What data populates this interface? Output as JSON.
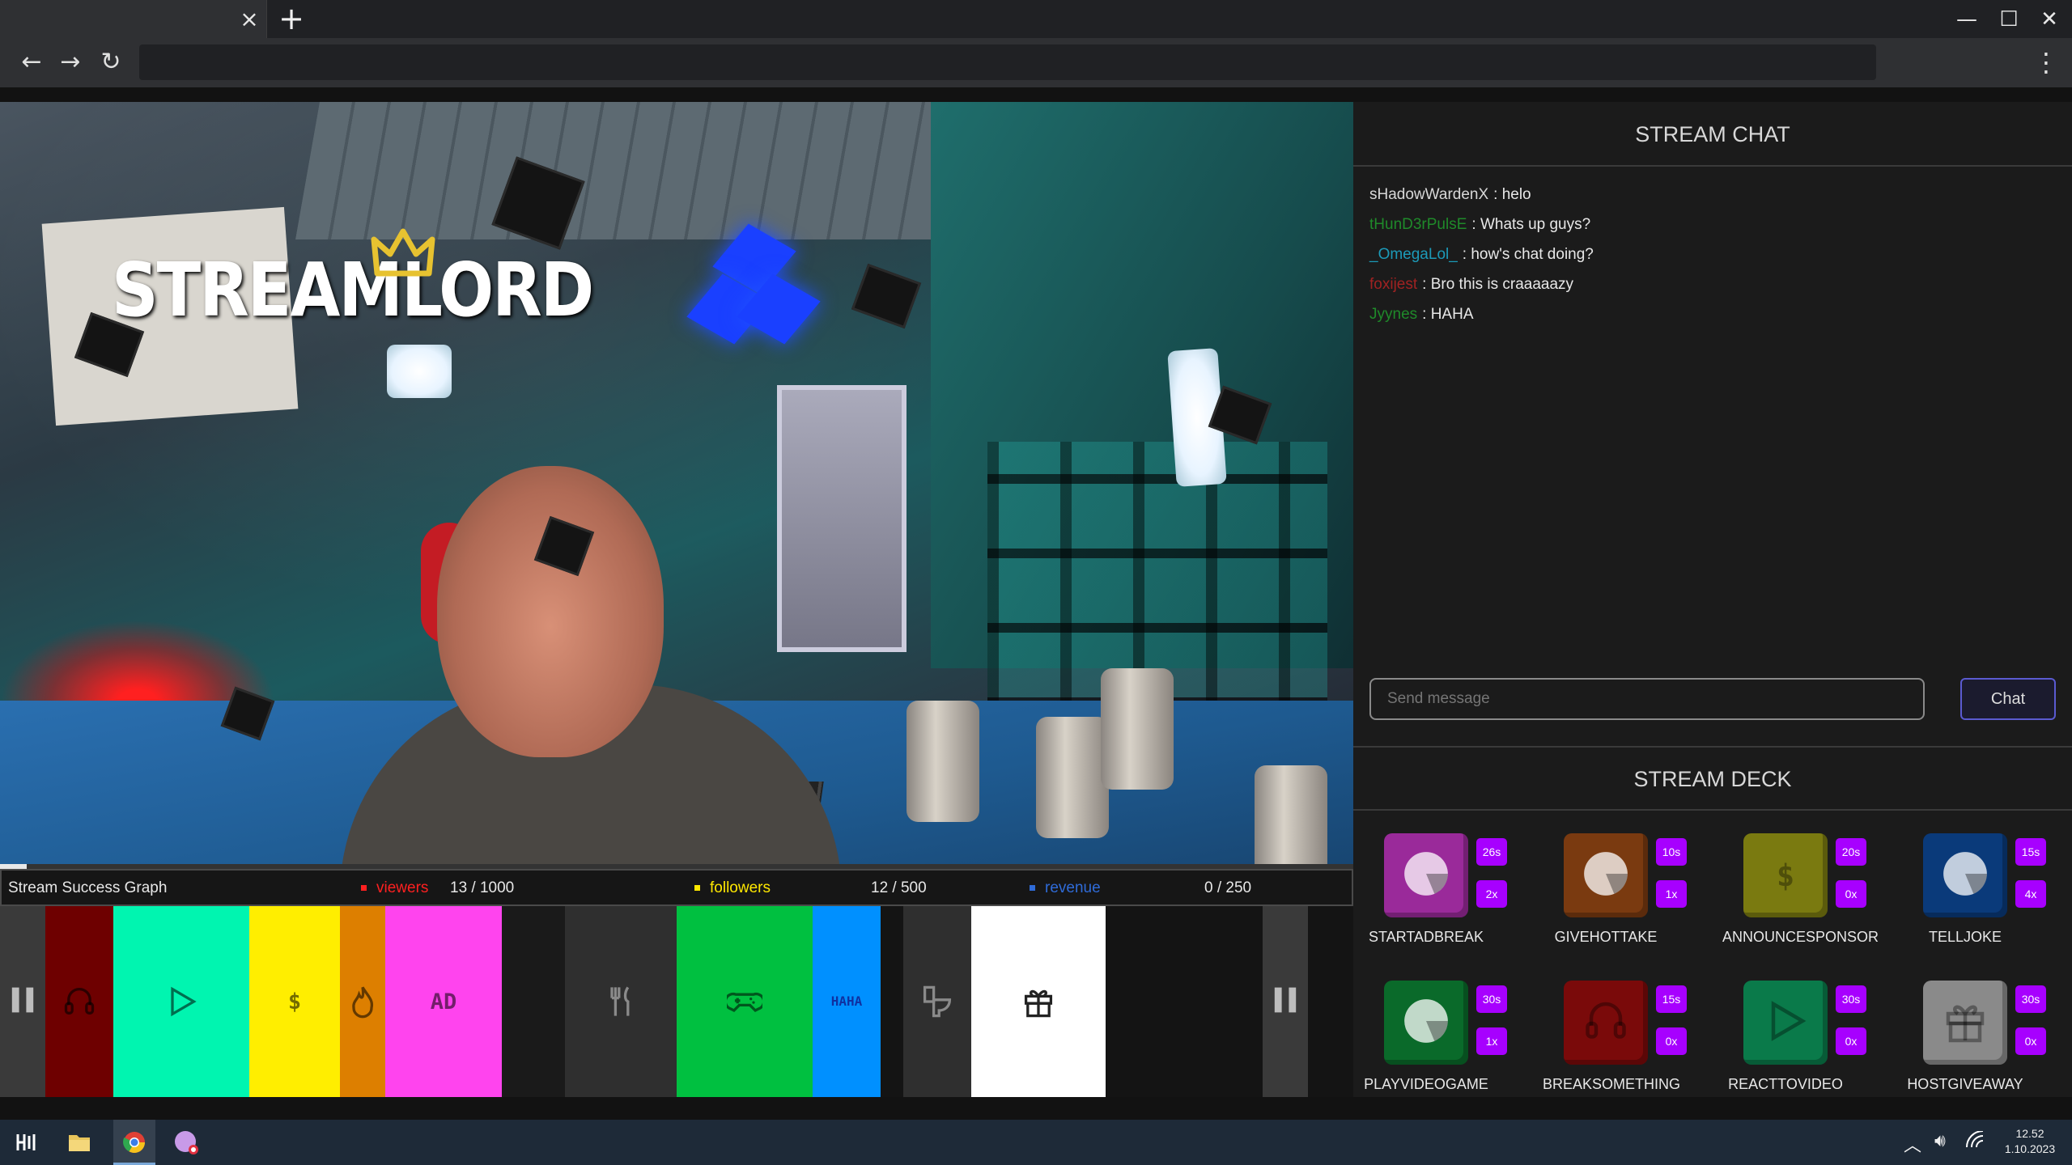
{
  "browser": {
    "tab_close": "×",
    "new_tab": "+",
    "address": "",
    "window": {
      "minimize": "—",
      "maximize": "☐",
      "close": "✕"
    },
    "nav": {
      "back": "←",
      "forward": "→",
      "reload": "↻",
      "menu": "⋮"
    }
  },
  "video": {
    "logo_text": "STREAMLORD",
    "progress_fraction": 0.02
  },
  "graph": {
    "title": "Stream Success Graph",
    "viewers": {
      "label": "viewers",
      "value": "13 / 1000",
      "color": "#ff2020"
    },
    "followers": {
      "label": "followers",
      "value": "12 / 500",
      "color": "#ffe800"
    },
    "revenue": {
      "label": "revenue",
      "value": "0 / 250",
      "color": "#2f6bd8"
    }
  },
  "strip_segments": [
    {
      "icon": "pause-icon",
      "color": "#3a3a3a"
    },
    {
      "icon": "headset-icon",
      "color": "#6e0000"
    },
    {
      "icon": "play-icon",
      "color": "#00f5b0"
    },
    {
      "icon": "dollar-icon",
      "color": "#ffee00",
      "text": "$"
    },
    {
      "icon": "fire-icon",
      "color": "#dd7f00"
    },
    {
      "icon": "ad-icon",
      "color": "#ff44ee",
      "text": "AD"
    },
    {
      "icon": "fork-knife-icon",
      "color": "#2f2f2f"
    },
    {
      "icon": "gamepad-icon",
      "color": "#00c040"
    },
    {
      "icon": "haha-icon",
      "color": "#0090ff",
      "text": "HAHA"
    },
    {
      "icon": "toilet-icon",
      "color": "#2f2f2f"
    },
    {
      "icon": "gift-icon",
      "color": "#ffffff"
    },
    {
      "icon": "pause-icon",
      "color": "#3a3a3a"
    }
  ],
  "chat": {
    "title": "STREAM CHAT",
    "messages": [
      {
        "user": "sHadowWardenX",
        "user_color": "#d8d8d8",
        "text": ": helo"
      },
      {
        "user": "tHunD3rPulsE",
        "user_color": "#1f8a2a",
        "text": ": Whats up guys?"
      },
      {
        "user": "_OmegaLol_",
        "user_color": "#1c9ab8",
        "text": ": how's chat doing?"
      },
      {
        "user": "foxijest",
        "user_color": "#a02222",
        "text": ": Bro this is craaaaazy"
      },
      {
        "user": "Jyynes",
        "user_color": "#1f8a2a",
        "text": ": HAHA"
      }
    ],
    "input_placeholder": "Send message",
    "send_label": "Chat"
  },
  "deck": {
    "title": "STREAM DECK",
    "items": [
      {
        "label": "STARTADBREAK",
        "time": "26s",
        "count": "2x",
        "color": "#9a2a9a",
        "icon": "ad-icon"
      },
      {
        "label": "GIVEHOTTAKE",
        "time": "10s",
        "count": "1x",
        "color": "#7a3a10",
        "icon": "fire-icon"
      },
      {
        "label": "ANNOUNCESPONSOR",
        "time": "20s",
        "count": "0x",
        "color": "#7a7a10",
        "icon": "dollar-icon"
      },
      {
        "label": "TELLJOKE",
        "time": "15s",
        "count": "4x",
        "color": "#0a3a7a",
        "icon": "haha-icon"
      },
      {
        "label": "PLAYVIDEOGAME",
        "time": "30s",
        "count": "1x",
        "color": "#0a6a2a",
        "icon": "gamepad-icon"
      },
      {
        "label": "BREAKSOMETHING",
        "time": "15s",
        "count": "0x",
        "color": "#7a0a0a",
        "icon": "headset-icon"
      },
      {
        "label": "REACTTOVIDEO",
        "time": "30s",
        "count": "0x",
        "color": "#0a7a4a",
        "icon": "play-icon"
      },
      {
        "label": "HOSTGIVEAWAY",
        "time": "30s",
        "count": "0x",
        "color": "#8a8a8a",
        "icon": "gift-icon"
      }
    ]
  },
  "taskbar": {
    "time": "12.52",
    "date": "1.10.2023"
  }
}
